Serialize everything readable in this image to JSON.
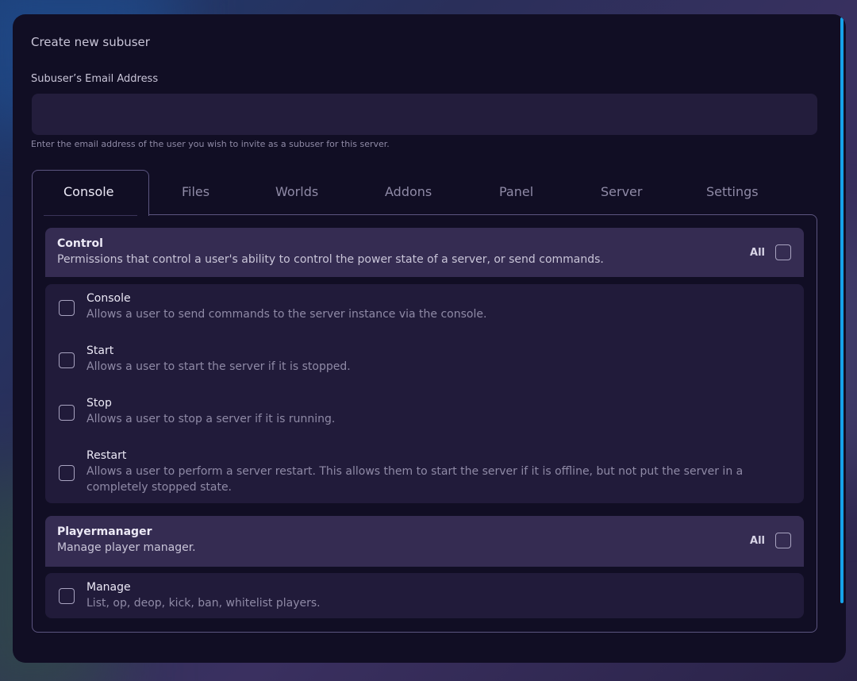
{
  "modal": {
    "title": "Create new subuser",
    "email_label": "Subuser’s Email Address",
    "email_value": "",
    "email_placeholder": "",
    "email_help": "Enter the email address of the user you wish to invite as a subuser for this server."
  },
  "tabs": [
    {
      "label": "Console",
      "active": true
    },
    {
      "label": "Files",
      "active": false
    },
    {
      "label": "Worlds",
      "active": false
    },
    {
      "label": "Addons",
      "active": false
    },
    {
      "label": "Panel",
      "active": false
    },
    {
      "label": "Server",
      "active": false
    },
    {
      "label": "Settings",
      "active": false
    }
  ],
  "groups": [
    {
      "title": "Control",
      "description": "Permissions that control a user's ability to control the power state of a server, or send commands.",
      "all_label": "All",
      "permissions": [
        {
          "title": "Console",
          "description": "Allows a user to send commands to the server instance via the console."
        },
        {
          "title": "Start",
          "description": "Allows a user to start the server if it is stopped."
        },
        {
          "title": "Stop",
          "description": "Allows a user to stop a server if it is running."
        },
        {
          "title": "Restart",
          "description": "Allows a user to perform a server restart. This allows them to start the server if it is offline, but not put the server in a completely stopped state."
        }
      ]
    },
    {
      "title": "Playermanager",
      "description": "Manage player manager.",
      "all_label": "All",
      "permissions": [
        {
          "title": "Manage",
          "description": "List, op, deop, kick, ban, whitelist players."
        }
      ]
    }
  ],
  "colors": {
    "accent": "#16a3ea",
    "modal_bg": "#110e24",
    "group_header_bg": "#352c52",
    "group_body_bg": "#211b3a"
  }
}
